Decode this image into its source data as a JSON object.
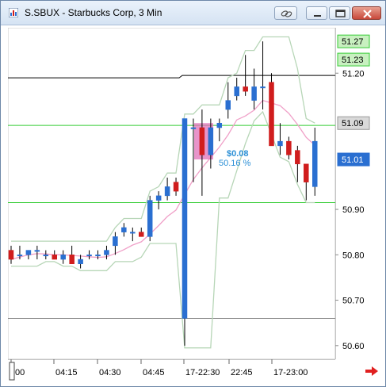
{
  "window": {
    "title": "S.SBUX - Starbucks Corp, 3 Min"
  },
  "titlebar_buttons": [
    {
      "name": "link-icon"
    },
    {
      "name": "restore-icon"
    },
    {
      "name": "maximize-icon"
    },
    {
      "name": "close-icon"
    }
  ],
  "colors": {
    "up_candle": "#2a6fd1",
    "down_candle": "#d01d1d",
    "green_lines": "#33cc33",
    "black_lines": "#000000",
    "band_line": "#b7d6b7",
    "ma_line": "#f0a0c8",
    "highlight_box": "#e070b8",
    "annotation": "#2b8fd6",
    "nav_arrow": "#e02020"
  },
  "annotation": {
    "change": "$0.08",
    "percent": "50.16 %"
  },
  "chart_data": {
    "type": "candlestick",
    "title": "S.SBUX - Starbucks Corp, 3 Min",
    "ylim": [
      50.57,
      51.3
    ],
    "y_ticks": [
      "50.60",
      "50.70",
      "50.80",
      "50.90",
      "51.01",
      "51.09",
      "51.20",
      "51.23",
      "51.27"
    ],
    "y_tick_values": [
      50.6,
      50.7,
      50.8,
      50.9,
      51.01,
      51.09,
      51.2,
      51.23,
      51.27
    ],
    "y_price_badges": [
      {
        "label": "51.27",
        "value": 51.27,
        "style": "green"
      },
      {
        "label": "51.23",
        "value": 51.23,
        "style": "green"
      },
      {
        "label": "51.09",
        "value": 51.09,
        "style": "gray"
      },
      {
        "label": "51.01",
        "value": 51.01,
        "style": "blue"
      }
    ],
    "x_tick_labels": [
      ":00",
      "04:15",
      "04:30",
      "04:45",
      "17-22:30",
      "22:45",
      "17-23:00"
    ],
    "horizontal_lines": [
      {
        "value": 51.085,
        "color": "green"
      },
      {
        "value": 50.915,
        "color": "green"
      },
      {
        "value": 51.195,
        "color": "black"
      },
      {
        "value": 50.66,
        "color": "gray"
      }
    ],
    "candles": [
      {
        "o": 50.81,
        "h": 50.82,
        "l": 50.78,
        "c": 50.79
      },
      {
        "o": 50.8,
        "h": 50.82,
        "l": 50.79,
        "c": 50.8
      },
      {
        "o": 50.8,
        "h": 50.81,
        "l": 50.79,
        "c": 50.81
      },
      {
        "o": 50.81,
        "h": 50.82,
        "l": 50.79,
        "c": 50.81
      },
      {
        "o": 50.8,
        "h": 50.81,
        "l": 50.79,
        "c": 50.8
      },
      {
        "o": 50.8,
        "h": 50.81,
        "l": 50.79,
        "c": 50.79
      },
      {
        "o": 50.79,
        "h": 50.81,
        "l": 50.78,
        "c": 50.8
      },
      {
        "o": 50.8,
        "h": 50.82,
        "l": 50.78,
        "c": 50.78
      },
      {
        "o": 50.78,
        "h": 50.8,
        "l": 50.77,
        "c": 50.79
      },
      {
        "o": 50.8,
        "h": 50.81,
        "l": 50.79,
        "c": 50.8
      },
      {
        "o": 50.8,
        "h": 50.81,
        "l": 50.79,
        "c": 50.8
      },
      {
        "o": 50.8,
        "h": 50.82,
        "l": 50.79,
        "c": 50.81
      },
      {
        "o": 50.82,
        "h": 50.85,
        "l": 50.8,
        "c": 50.84
      },
      {
        "o": 50.85,
        "h": 50.87,
        "l": 50.84,
        "c": 50.86
      },
      {
        "o": 50.85,
        "h": 50.86,
        "l": 50.83,
        "c": 50.85
      },
      {
        "o": 50.85,
        "h": 50.86,
        "l": 50.84,
        "c": 50.84
      },
      {
        "o": 50.84,
        "h": 50.93,
        "l": 50.83,
        "c": 50.92
      },
      {
        "o": 50.92,
        "h": 50.94,
        "l": 50.9,
        "c": 50.93
      },
      {
        "o": 50.93,
        "h": 50.97,
        "l": 50.92,
        "c": 50.95
      },
      {
        "o": 50.96,
        "h": 50.97,
        "l": 50.93,
        "c": 50.94
      },
      {
        "o": 50.66,
        "h": 51.1,
        "l": 50.6,
        "c": 51.1
      },
      {
        "o": 51.08,
        "h": 51.1,
        "l": 50.96,
        "c": 51.08
      },
      {
        "o": 51.08,
        "h": 51.12,
        "l": 50.93,
        "c": 51.02
      },
      {
        "o": 51.02,
        "h": 51.1,
        "l": 50.99,
        "c": 51.08
      },
      {
        "o": 51.08,
        "h": 51.1,
        "l": 51.05,
        "c": 51.09
      },
      {
        "o": 51.12,
        "h": 51.18,
        "l": 51.1,
        "c": 51.14
      },
      {
        "o": 51.15,
        "h": 51.19,
        "l": 51.14,
        "c": 51.17
      },
      {
        "o": 51.17,
        "h": 51.24,
        "l": 51.15,
        "c": 51.16
      },
      {
        "o": 51.14,
        "h": 51.21,
        "l": 51.12,
        "c": 51.17
      },
      {
        "o": 51.17,
        "h": 51.27,
        "l": 51.12,
        "c": 51.17
      },
      {
        "o": 51.18,
        "h": 51.2,
        "l": 51.07,
        "c": 51.04
      },
      {
        "o": 51.04,
        "h": 51.09,
        "l": 51.02,
        "c": 51.05
      },
      {
        "o": 51.05,
        "h": 51.06,
        "l": 51.01,
        "c": 51.02
      },
      {
        "o": 51.03,
        "h": 51.04,
        "l": 50.96,
        "c": 51.0
      },
      {
        "o": 51.0,
        "h": 51.0,
        "l": 50.92,
        "c": 50.96
      },
      {
        "o": 50.95,
        "h": 51.08,
        "l": 50.93,
        "c": 51.05
      }
    ]
  }
}
